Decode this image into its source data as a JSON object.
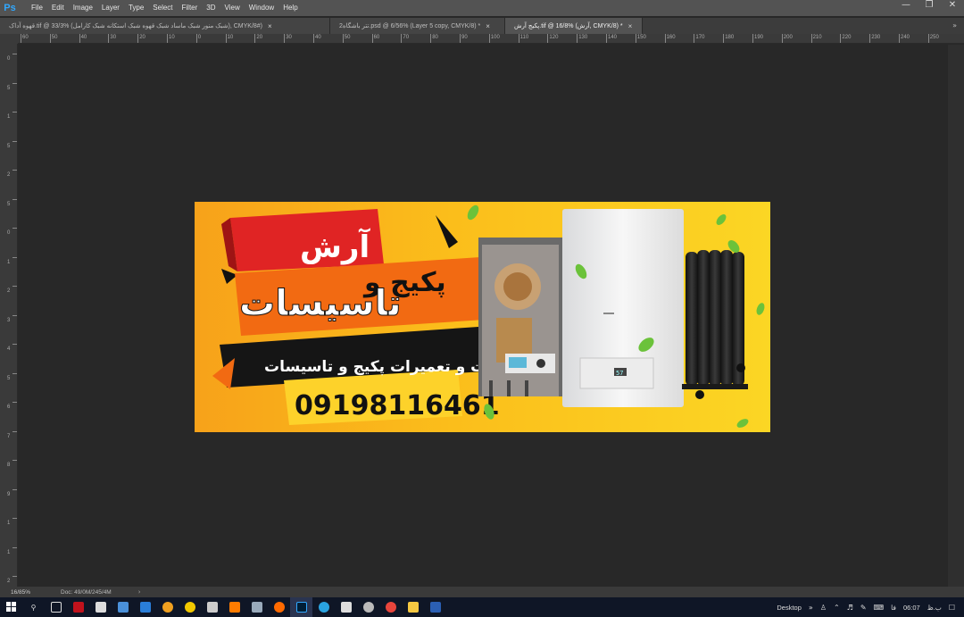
{
  "app": {
    "logo": "Ps",
    "menu": [
      "File",
      "Edit",
      "Image",
      "Layer",
      "Type",
      "Select",
      "Filter",
      "3D",
      "View",
      "Window",
      "Help"
    ]
  },
  "tabs": [
    {
      "label": "قهوه آداک.tif @ 33/3% (شبک منور شبک ماساد شبک قهوه شبک استکانه شبک کارامل), CMYK/8#)",
      "active": false
    },
    {
      "label": "تتر باشگاه2.psd @ 6/56% (Layer 5 copy, CMYK/8) *",
      "active": false
    },
    {
      "label": "پکیج آرش.tif @ 16/8% (آرش, CMYK/8) *",
      "active": true
    }
  ],
  "ruler_top_labels": [
    "60",
    "50",
    "40",
    "30",
    "20",
    "10",
    "0",
    "10",
    "20",
    "30",
    "40",
    "50",
    "60",
    "70",
    "80",
    "90",
    "100",
    "110",
    "120",
    "130",
    "140",
    "150",
    "160",
    "170",
    "180",
    "190",
    "200",
    "210",
    "220",
    "230",
    "240",
    "250"
  ],
  "ruler_left_labels": [
    "0",
    "5",
    "1",
    "5",
    "2",
    "5",
    "0",
    "1",
    "2",
    "3",
    "4",
    "5",
    "6",
    "7",
    "8",
    "9",
    "1",
    "1",
    "2",
    "3"
  ],
  "banner": {
    "brand": "آرش",
    "product": "پکیج و",
    "product2": "تاسیسات",
    "tagline": "خدمات و تعمیرات پکیج و تاسیسات",
    "phone": "09198116461",
    "boiler_display": "57"
  },
  "status": {
    "zoom": "16/85%",
    "doc": "Doc: 49/0M/245/4M"
  },
  "taskbar": {
    "desktop_label": "Desktop",
    "lang": "فا",
    "time": "06:07",
    "ampm": "ب.ظ"
  }
}
